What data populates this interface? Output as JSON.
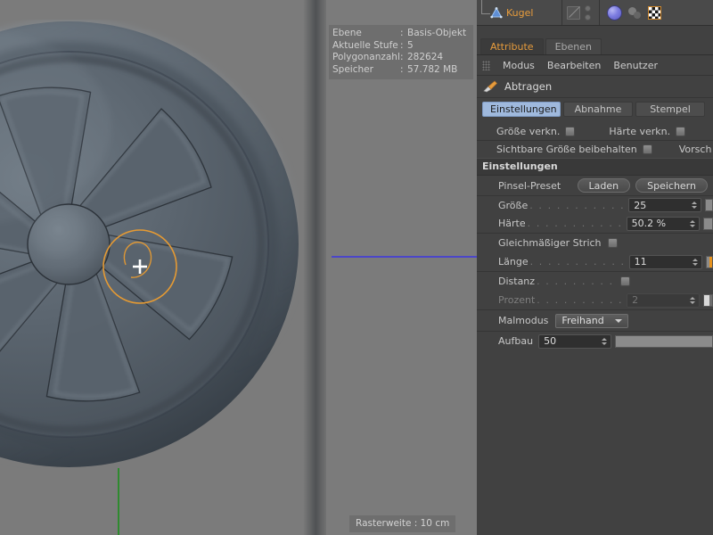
{
  "viewport": {
    "hud": {
      "rows": [
        {
          "key": "Ebene",
          "sep": ":",
          "value": "Basis-Objekt"
        },
        {
          "key": "Aktuelle Stufe",
          "sep": ":",
          "value": "5"
        },
        {
          "key": "Polygonanzahl",
          "sep": ":",
          "value": "282624"
        },
        {
          "key": "Speicher",
          "sep": ":",
          "value": "57.782 MB"
        }
      ]
    },
    "status": "Rasterweite : 10 cm",
    "axis_x_color": "#4b46c8",
    "axis_y_color": "#2f8a2f",
    "brush_cursor_color": "#e59a33",
    "background_color": "#7b7b7b",
    "object_color": "#505a63"
  },
  "object_manager": {
    "object_name": "Kugel",
    "object_name_color": "#e79c3c",
    "icons": {
      "object": "cone-object-icon",
      "no_render": "no-render-icon",
      "visibility_dots": "visibility-dots-icon",
      "tag_sphere": "sculpt-tag-icon",
      "tag_blob": "phong-tag-icon",
      "tag_checker": "texture-tag-icon"
    }
  },
  "panel": {
    "tabs": [
      {
        "label": "Attribute",
        "active": true
      },
      {
        "label": "Ebenen",
        "active": false
      }
    ],
    "menu": [
      "Modus",
      "Bearbeiten",
      "Benutzer"
    ],
    "tool_title": "Abtragen",
    "tool_tabs": [
      {
        "label": "Einstellungen",
        "active": true
      },
      {
        "label": "Abnahme",
        "active": false
      },
      {
        "label": "Stempel",
        "active": false
      }
    ],
    "link_row": [
      {
        "label": "Größe verkn.",
        "checked": false
      },
      {
        "label": "Härte verkn.",
        "checked": false
      }
    ],
    "keep_row": [
      {
        "label": "Sichtbare Größe beibehalten",
        "checked": false
      },
      {
        "label": "Vorsch",
        "checked": false
      }
    ],
    "settings_section": "Einstellungen",
    "preset": {
      "label": "Pinsel-Preset",
      "load_button": "Laden",
      "save_button": "Speichern"
    },
    "size": {
      "label": "Größe",
      "value": "25",
      "slider_percent": 0
    },
    "hardness": {
      "label": "Härte",
      "value": "50.2 %",
      "slider_percent": 0
    },
    "even_stroke": {
      "label": "Gleichmäßiger Strich",
      "checked": false
    },
    "length": {
      "label": "Länge",
      "value": "11",
      "slider_percent": 31
    },
    "distance": {
      "label": "Distanz",
      "checked": false
    },
    "percent": {
      "label": "Prozent",
      "value": "2",
      "slider_percent": 2,
      "disabled": true
    },
    "paint_mode": {
      "label": "Malmodus",
      "value": "Freihand"
    },
    "buildup": {
      "label": "Aufbau",
      "value": "50",
      "slider_percent": 0
    }
  }
}
